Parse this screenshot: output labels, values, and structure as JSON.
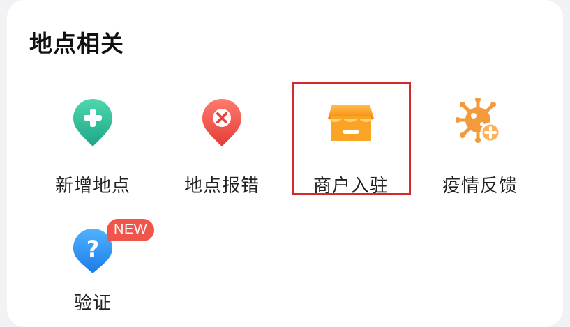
{
  "section": {
    "title": "地点相关"
  },
  "items": [
    {
      "label": "新增地点",
      "icon": "add-location-icon",
      "color": "#2fbf9a"
    },
    {
      "label": "地点报错",
      "icon": "error-location-icon",
      "color": "#f0524a"
    },
    {
      "label": "商户入驻",
      "icon": "shop-icon",
      "color": "#f7a21c"
    },
    {
      "label": "疫情反馈",
      "icon": "virus-icon",
      "color": "#f39a3b"
    },
    {
      "label": "验证",
      "icon": "question-icon",
      "color": "#2d8ef5",
      "badge": "NEW"
    }
  ],
  "highlight_color": "#d42a2a"
}
